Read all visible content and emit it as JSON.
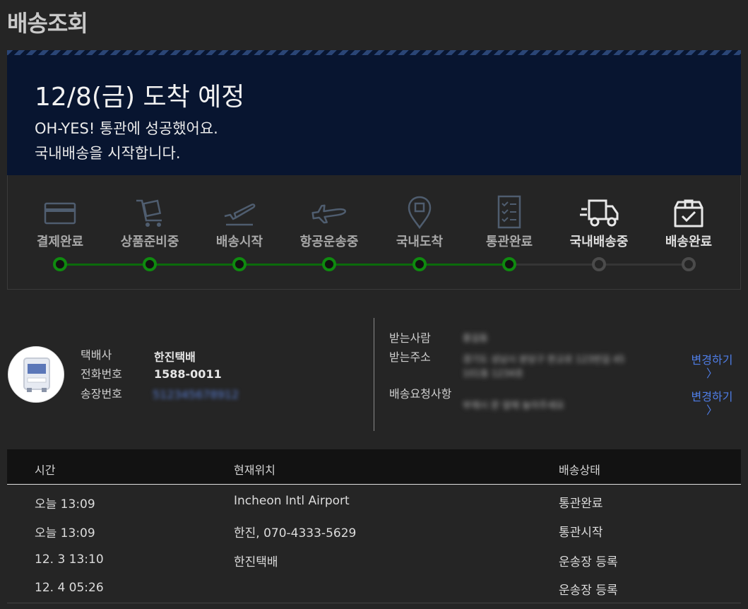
{
  "page": {
    "title": "배송조회"
  },
  "banner": {
    "headline": "12/8(금) 도착 예정",
    "line1": "OH-YES! 통관에 성공했어요.",
    "line2": "국내배송을 시작합니다."
  },
  "steps": [
    {
      "label": "결제완료",
      "icon": "card-icon",
      "state": "done"
    },
    {
      "label": "상품준비중",
      "icon": "cart-box-icon",
      "state": "done"
    },
    {
      "label": "배송시작",
      "icon": "plane-takeoff-icon",
      "state": "done"
    },
    {
      "label": "항공운송중",
      "icon": "plane-icon",
      "state": "done"
    },
    {
      "label": "국내도착",
      "icon": "location-pin-icon",
      "state": "done"
    },
    {
      "label": "통관완료",
      "icon": "checklist-icon",
      "state": "done"
    },
    {
      "label": "국내배송중",
      "icon": "truck-icon",
      "state": "pending"
    },
    {
      "label": "배송완료",
      "icon": "box-check-icon",
      "state": "pending"
    }
  ],
  "courier": {
    "company_label": "택배사",
    "company_value": "한진택배",
    "phone_label": "전화번호",
    "phone_value": "1588-0011",
    "tracking_label": "송장번호",
    "tracking_value": "512345678912"
  },
  "recipient": {
    "name_label": "받는사람",
    "name_value": "홍길동",
    "address_label": "받는주소",
    "address_line1": "경기도 성남시 분당구 판교로 123번길 45",
    "address_line2": "101동 1234호",
    "request_label": "배송요청사항",
    "request_value": "부재시 문 앞에 놓아주세요",
    "change_label": "변경하기",
    "chevron": "〉"
  },
  "history": {
    "headers": {
      "time": "시간",
      "location": "현재위치",
      "status": "배송상태"
    },
    "rows": [
      {
        "time": "오늘 13:09",
        "location": "Incheon Intl Airport",
        "status": "통관완료"
      },
      {
        "time": "오늘 13:09",
        "location": "한진, 070-4333-5629",
        "status": "통관시작"
      },
      {
        "time": "12. 3 13:10",
        "location": "한진택배",
        "status": "운송장 등록"
      },
      {
        "time": "12. 4 05:26",
        "location": "",
        "status": "운송장 등록"
      }
    ]
  },
  "colors": {
    "banner_bg": "#081530",
    "progress_done": "#0f8a0f",
    "progress_pending": "#4b4b4b",
    "link": "#4f7ee8"
  }
}
